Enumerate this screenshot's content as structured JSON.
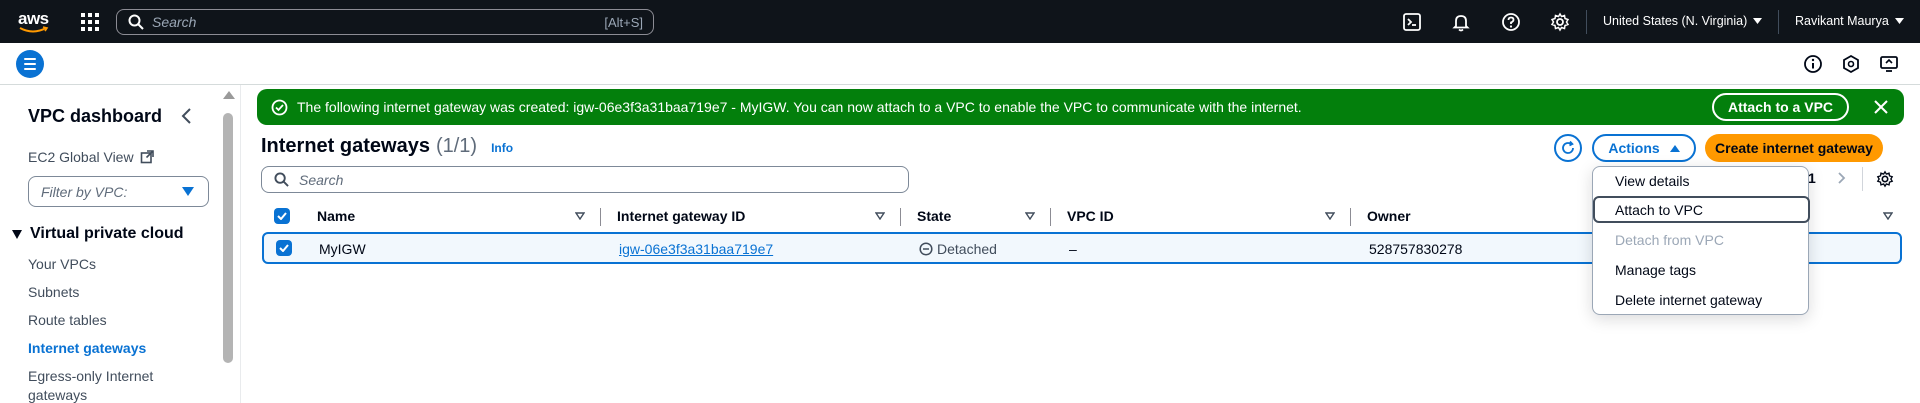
{
  "topnav": {
    "logo_text": "aws",
    "search_placeholder": "Search",
    "search_shortcut": "[Alt+S]",
    "region": "United States (N. Virginia)",
    "user": "Ravikant Maurya",
    "icons": [
      "cloudshell-icon",
      "bell-icon",
      "help-icon",
      "gear-icon"
    ]
  },
  "sidebar": {
    "title": "VPC dashboard",
    "ec2_global_view": "EC2 Global View",
    "filter_placeholder": "Filter by VPC:",
    "section": "Virtual private cloud",
    "items": [
      {
        "label": "Your VPCs",
        "active": false
      },
      {
        "label": "Subnets",
        "active": false
      },
      {
        "label": "Route tables",
        "active": false
      },
      {
        "label": "Internet gateways",
        "active": true
      },
      {
        "label": "Egress-only Internet",
        "active": false
      },
      {
        "label": "gateways",
        "active": false
      }
    ]
  },
  "flash": {
    "message": "The following internet gateway was created: igw-06e3f3a31baa719e7 - MyIGW. You can now attach to a VPC to enable the VPC to communicate with the internet.",
    "action_label": "Attach to a VPC",
    "color": "#037f0c"
  },
  "header": {
    "title": "Internet gateways",
    "count": "(1/1)",
    "info": "Info",
    "actions_label": "Actions",
    "create_label": "Create internet gateway",
    "search_placeholder": "Search",
    "page_number": "1"
  },
  "table": {
    "columns": [
      "Name",
      "Internet gateway ID",
      "State",
      "VPC ID",
      "Owner"
    ],
    "rows": [
      {
        "selected": true,
        "name": "MyIGW",
        "igw_id": "igw-06e3f3a31baa719e7",
        "state": "Detached",
        "vpc_id": "–",
        "owner": "528757830278"
      }
    ]
  },
  "actions_menu": {
    "items": [
      {
        "label": "View details",
        "disabled": false
      },
      {
        "label": "Attach to VPC",
        "disabled": false,
        "focused": true
      },
      {
        "label": "Detach from VPC",
        "disabled": true
      },
      {
        "label": "Manage tags",
        "disabled": false
      },
      {
        "label": "Delete internet gateway",
        "disabled": false
      }
    ]
  },
  "colors": {
    "nav_bg": "#0f141a",
    "accent": "#0972d3",
    "primary_button": "#ff9900",
    "success": "#037f0c"
  }
}
